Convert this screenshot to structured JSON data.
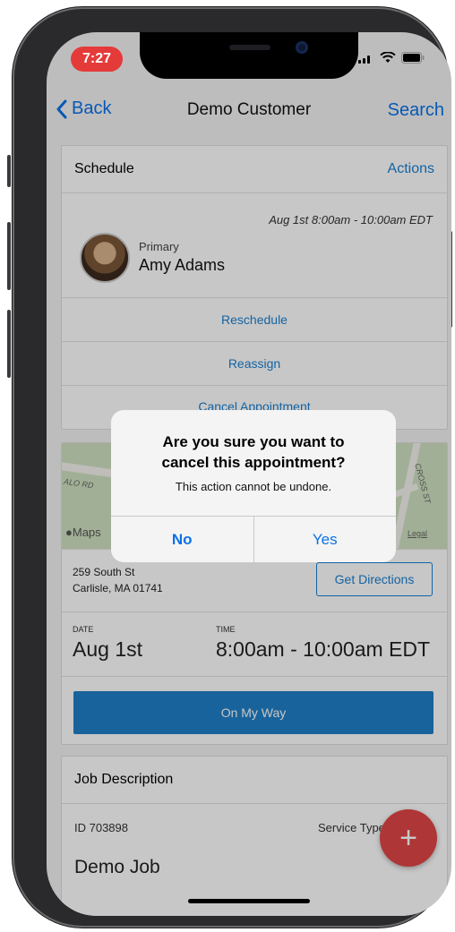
{
  "status_bar": {
    "time": "7:27"
  },
  "nav": {
    "back_label": "Back",
    "title": "Demo Customer",
    "search_label": "Search"
  },
  "schedule": {
    "header": "Schedule",
    "actions_label": "Actions",
    "appointment_time": "Aug 1st 8:00am - 10:00am EDT",
    "assignee_role": "Primary",
    "assignee_name": "Amy Adams",
    "reschedule_label": "Reschedule",
    "reassign_label": "Reassign",
    "cancel_label": "Cancel Appointment"
  },
  "location": {
    "map_labels": {
      "road_left": "ALO RD",
      "road_right": "CROSS ST",
      "maps_brand": "Maps",
      "legal": "Legal"
    },
    "address_line1": "259 South St",
    "address_line2": "Carlisle, MA 01741",
    "directions_label": "Get Directions",
    "date_label": "DATE",
    "date_value": "Aug 1st",
    "time_label": "TIME",
    "time_value": "8:00am - 10:00am EDT",
    "on_my_way_label": "On My Way"
  },
  "job": {
    "header": "Job Description",
    "id_text": "ID 703898",
    "service_type_label": "Service Type",
    "name": "Demo Job"
  },
  "fab": {
    "label": "+"
  },
  "dialog": {
    "title_line1": "Are you sure you want to",
    "title_line2": "cancel this appointment?",
    "message": "This action cannot be undone.",
    "no_label": "No",
    "yes_label": "Yes"
  },
  "colors": {
    "accent": "#0a72e8",
    "link": "#1a7fd0",
    "primary_button": "#1f7fc7",
    "fab": "#e04646",
    "time_pill": "#e53a3a"
  }
}
